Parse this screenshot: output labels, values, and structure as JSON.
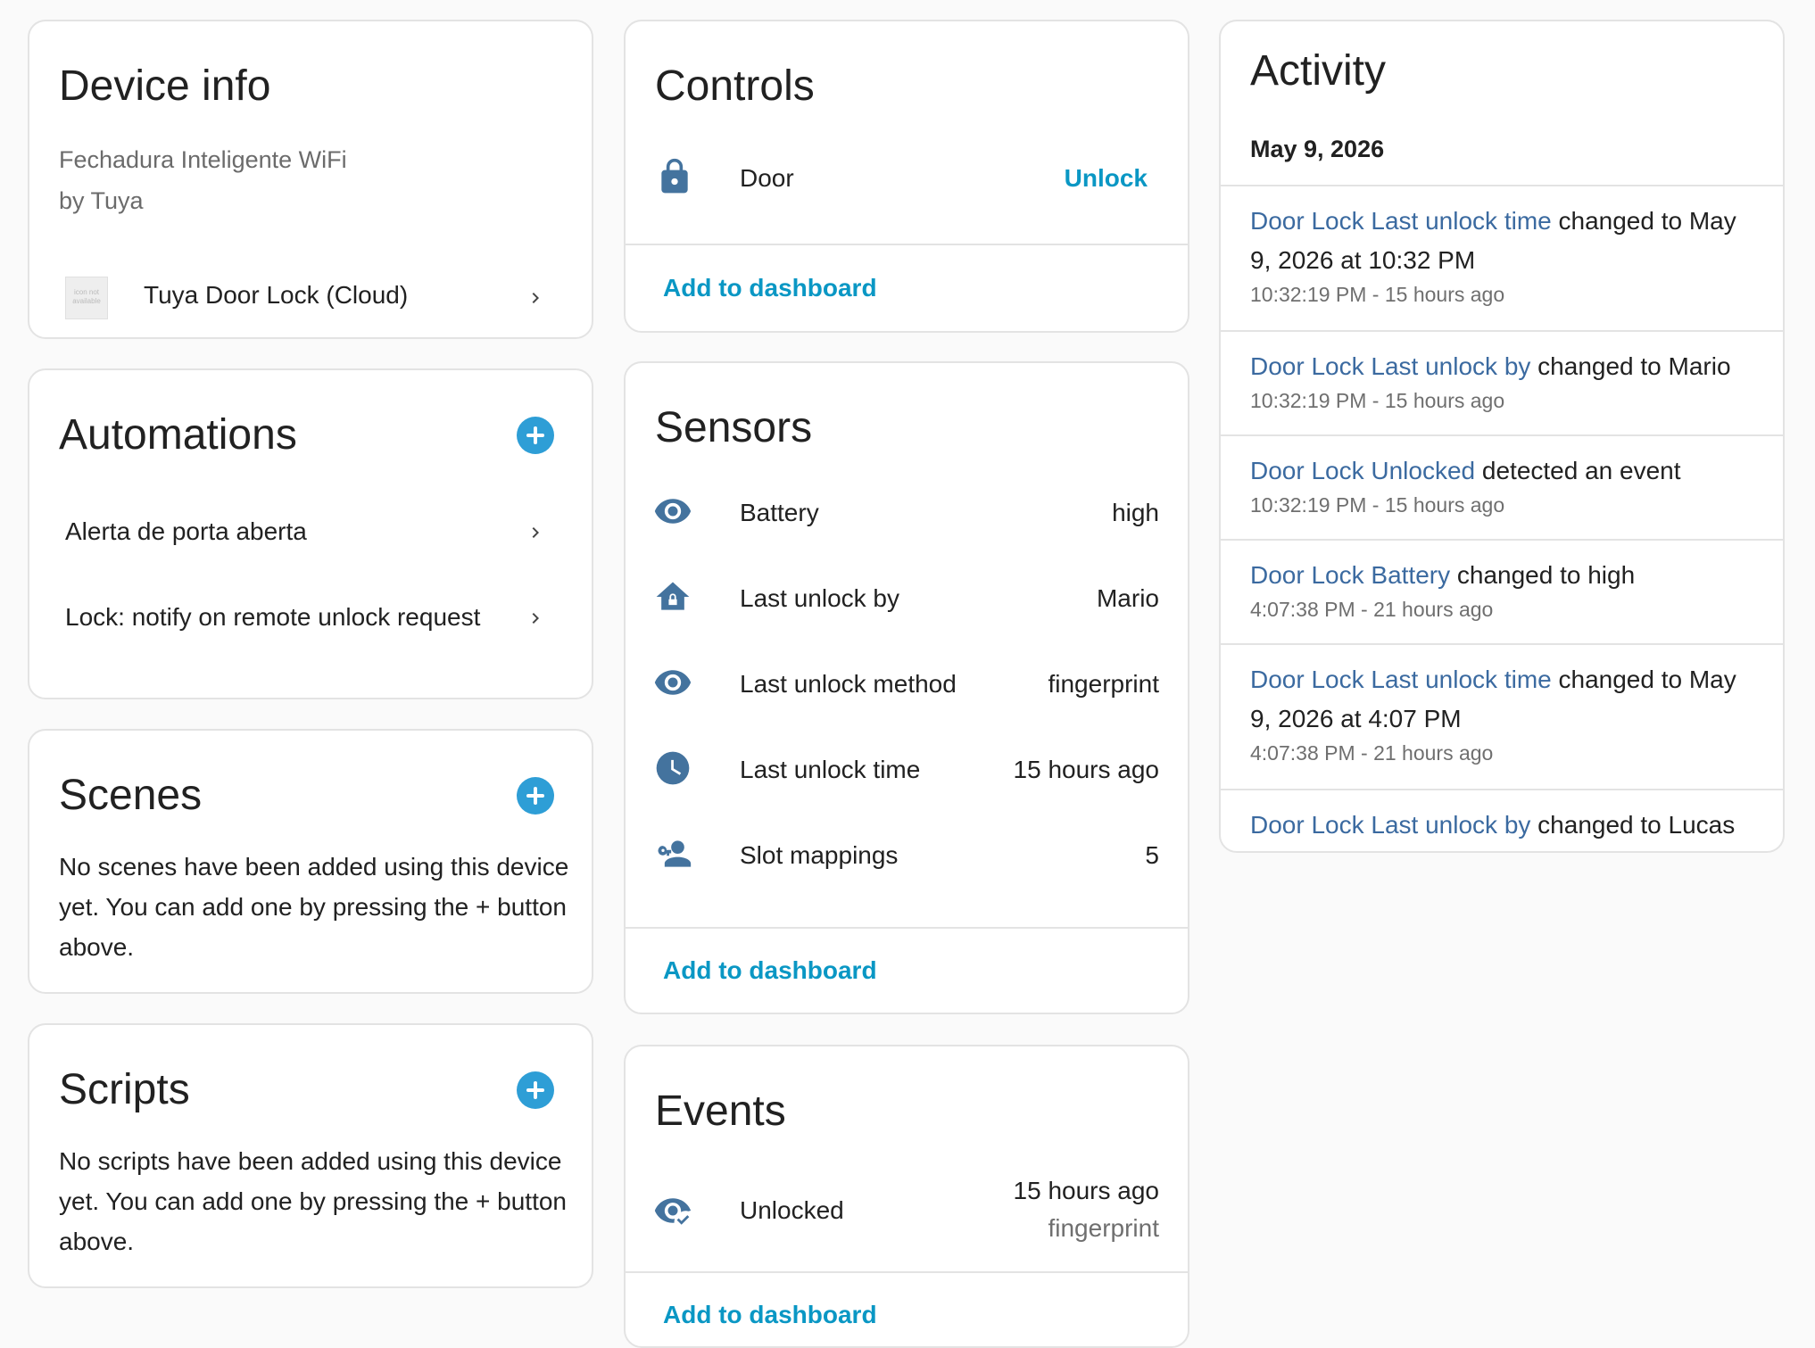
{
  "device_info": {
    "title": "Device info",
    "model": "Fechadura Inteligente WiFi",
    "manufacturer": "by Tuya",
    "integration_icon_text": "icon not available",
    "integration": "Tuya Door Lock (Cloud)"
  },
  "automations": {
    "title": "Automations",
    "items": [
      {
        "label": "Alerta de porta aberta"
      },
      {
        "label": "Lock: notify on remote unlock request"
      }
    ]
  },
  "scenes": {
    "title": "Scenes",
    "empty_text": "No scenes have been added using this device yet. You can add one by pressing the + button above."
  },
  "scripts": {
    "title": "Scripts",
    "empty_text": "No scripts have been added using this device yet. You can add one by pressing the + button above."
  },
  "controls": {
    "title": "Controls",
    "door_label": "Door",
    "door_action": "Unlock",
    "add_to_dashboard": "Add to dashboard"
  },
  "sensors": {
    "title": "Sensors",
    "rows": [
      {
        "icon": "eye-icon",
        "label": "Battery",
        "value": "high"
      },
      {
        "icon": "home-lock-icon",
        "label": "Last unlock by",
        "value": "Mario"
      },
      {
        "icon": "eye-icon",
        "label": "Last unlock method",
        "value": "fingerprint"
      },
      {
        "icon": "clock-icon",
        "label": "Last unlock time",
        "value": "15 hours ago"
      },
      {
        "icon": "account-key-icon",
        "label": "Slot mappings",
        "value": "5"
      }
    ],
    "add_to_dashboard": "Add to dashboard"
  },
  "events": {
    "title": "Events",
    "label": "Unlocked",
    "time": "15 hours ago",
    "detail": "fingerprint",
    "add_to_dashboard": "Add to dashboard"
  },
  "activity": {
    "title": "Activity",
    "date": "May 9, 2026",
    "items": [
      {
        "entity": "Door Lock Last unlock time",
        "text": " changed to May 9, 2026 at 10:32 PM",
        "time": "10:32:19 PM - 15 hours ago"
      },
      {
        "entity": "Door Lock Last unlock by",
        "text": " changed to Mario",
        "time": "10:32:19 PM - 15 hours ago"
      },
      {
        "entity": "Door Lock Unlocked",
        "text": " detected an event",
        "time": "10:32:19 PM - 15 hours ago"
      },
      {
        "entity": "Door Lock Battery",
        "text": " changed to high",
        "time": "4:07:38 PM - 21 hours ago"
      },
      {
        "entity": "Door Lock Last unlock time",
        "text": " changed to May 9, 2026 at 4:07 PM",
        "time": "4:07:38 PM - 21 hours ago"
      },
      {
        "entity": "Door Lock Last unlock by",
        "text": " changed to Lucas",
        "time": ""
      }
    ]
  },
  "colors": {
    "accent": "#0a97c4",
    "plus_button": "#2e9ed6",
    "entity_link": "#3b6aa0",
    "icon": "#44739e"
  }
}
